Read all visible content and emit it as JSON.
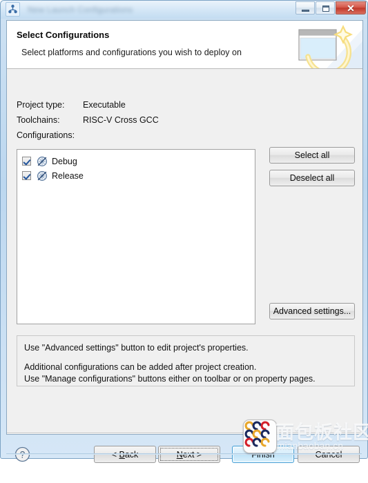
{
  "window": {
    "title": "New Launch Configurations",
    "title_blurred": true,
    "icon": "app-icon",
    "controls": {
      "minimize": "–",
      "maximize": "□",
      "close": "✕"
    }
  },
  "header": {
    "title": "Select Configurations",
    "subtitle": "Select platforms and configurations you wish to deploy on",
    "banner_icon": "new-project-wizard-banner-icon"
  },
  "fields": {
    "project_type_label": "Project type:",
    "project_type_value": "Executable",
    "toolchains_label": "Toolchains:",
    "toolchains_value": "RISC-V Cross GCC",
    "configurations_label": "Configurations:"
  },
  "configurations": [
    {
      "label": "Debug",
      "checked": true,
      "icon": "build-configuration-icon"
    },
    {
      "label": "Release",
      "checked": true,
      "icon": "build-configuration-icon"
    }
  ],
  "side_buttons": {
    "select_all": "Select all",
    "deselect_all": "Deselect all",
    "advanced_settings": "Advanced settings..."
  },
  "message_panel": {
    "line1": "Use \"Advanced settings\" button to edit project's properties.",
    "line2": "Additional configurations can be added after project creation.",
    "line3": "Use \"Manage configurations\" buttons either on toolbar or on property pages."
  },
  "footer": {
    "help_icon": "help-icon",
    "back": "< Back",
    "next": "Next >",
    "finish": "Finish",
    "cancel": "Cancel",
    "default_button": "Finish",
    "focused_button": "Next >"
  },
  "watermark": {
    "logo": "mianbaoban-logo",
    "chinese": "面包板社区",
    "domain": "mianbaoban.cn"
  },
  "colors": {
    "accent": "#3c9bd4",
    "close_button": "#c0392b",
    "window_frame": "#bcd7ef",
    "client_bg": "#f0f0f0",
    "header_bg": "#ffffff",
    "checkbox_check": "#23559c"
  }
}
